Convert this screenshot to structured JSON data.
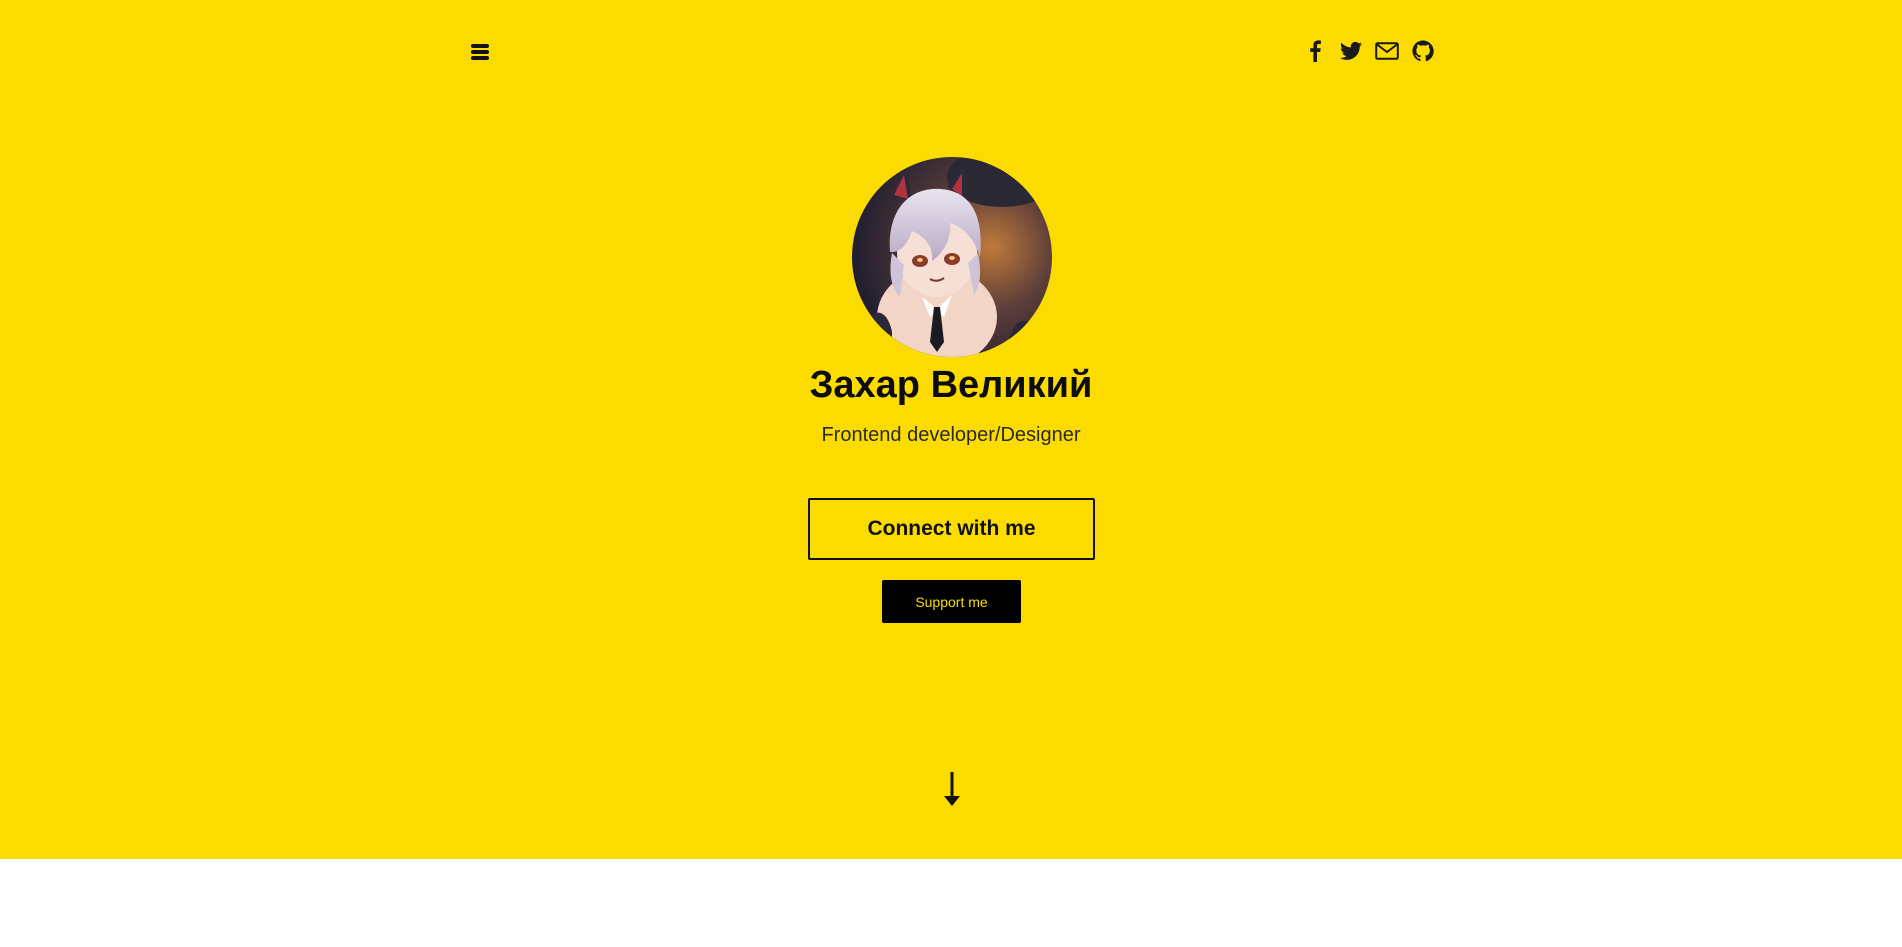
{
  "profile": {
    "name": "Захар Великий",
    "title": "Frontend developer/Designer"
  },
  "actions": {
    "connect_label": "Connect with me",
    "support_label": "Support me"
  },
  "nav": {
    "menu_icon": "hamburger-menu-icon",
    "social": [
      "facebook-icon",
      "twitter-icon",
      "mail-icon",
      "github-icon"
    ]
  },
  "colors": {
    "hero_background": "#fcdc00",
    "text": "#0d0d0d",
    "support_button_bg": "#000000",
    "support_button_text": "#fcdc00"
  }
}
